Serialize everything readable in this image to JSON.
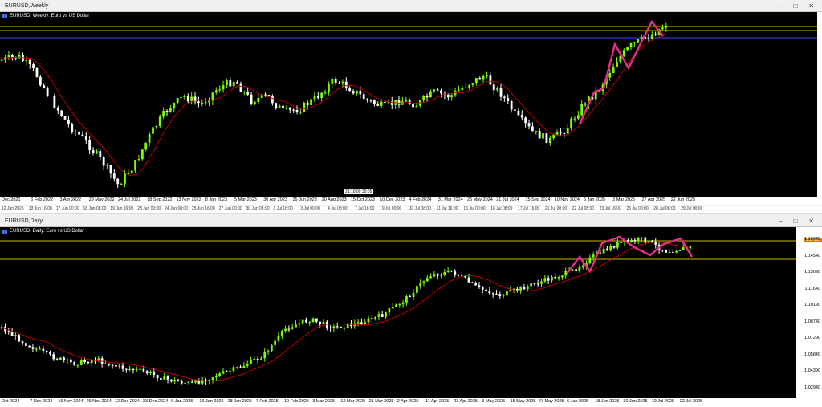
{
  "weekly": {
    "window_title": "EURUSD,Weekly",
    "chart_label": "EURUSD, Weekly: Euro vs US Dollar",
    "x_labels": [
      "Dec 2021",
      "6 Feb 2022",
      "3 Apr 2022",
      "29 May 2022",
      "24 Jul 2022",
      "18 Sep 2022",
      "13 Nov 2022",
      "8 Jan 2023",
      "5 Mar 2023",
      "30 Apr 2023",
      "25 Jun 2023",
      "20 Aug 2023",
      "15 Oct 2023",
      "10 Dec 2023",
      "4 Feb 2024",
      "31 Mar 2024",
      "26 May 2024",
      "21 Jul 2024",
      "15 Sep 2024",
      "10 Nov 2024",
      "5 Jan 2025",
      "2 Mar 2025",
      "27 Apr 2025",
      "22 Jun 2025"
    ],
    "crosshair_tag": "21:10:00 30:05"
  },
  "strip_labels": [
    "12 Jun 2025",
    "13 Jun 16:00",
    "17 Jun 00:00",
    "18 Jun 08:00",
    "19 Jun 16:00",
    "23 Jun 00:00",
    "24 Jun 08:00",
    "25 Jun 16:00",
    "27 Jun 00:00",
    "30 Jun 08:00",
    "1 Jul 16:00",
    "3 Jul 00:00",
    "4 Jul 08:00",
    "7 Jul 16:00",
    "9 Jul 00:00",
    "10 Jul 08:00",
    "11 Jul 16:00",
    "15 Jul 00:00",
    "16 Jul 08:00",
    "17 Jul 16:00",
    "21 Jul 00:00",
    "22 Jul 08:00",
    "23 Jul 16:00",
    "25 Jul 00:00",
    "28 Jul 08:00",
    "29 Jul 00:00"
  ],
  "daily": {
    "window_title": "EURUSD,Daily",
    "chart_label": "EURUSD, Daily: Euro vs US Dollar",
    "x_labels": [
      "Oct 2024",
      "7 Nov 2024",
      "19 Nov 2024",
      "29 Nov 2024",
      "12 Dec 2024",
      "23 Dec 2024",
      "6 Jan 2025",
      "16 Jan 2025",
      "28 Jan 2025",
      "7 Feb 2025",
      "19 Feb 2025",
      "3 Mar 2025",
      "12 Mar 2025",
      "21 Mar 2025",
      "2 Apr 2025",
      "11 Apr 2025",
      "23 Apr 2025",
      "5 May 2025",
      "15 May 2025",
      "27 May 2025",
      "6 Jun 2025",
      "18 Jun 2025",
      "30 Jun 2025",
      "10 Jul 2025",
      "22 Jul 2025"
    ],
    "y_labels": [
      "1.16945",
      "1.14540",
      "1.13090",
      "1.11640",
      "1.10190",
      "1.08740",
      "1.07290",
      "1.05840",
      "1.04390",
      "1.02940"
    ],
    "price_tag": "1.17683"
  },
  "colors": {
    "bull": "#7cfc00",
    "bear": "#ffffff",
    "ma": "#c00000",
    "zigzag": "#e0308a",
    "level": "#c8b400",
    "blue_line": "#3050ff"
  },
  "icons": {
    "close": "close-icon",
    "maximize": "maximize-icon",
    "minimize": "minimize-icon"
  }
}
